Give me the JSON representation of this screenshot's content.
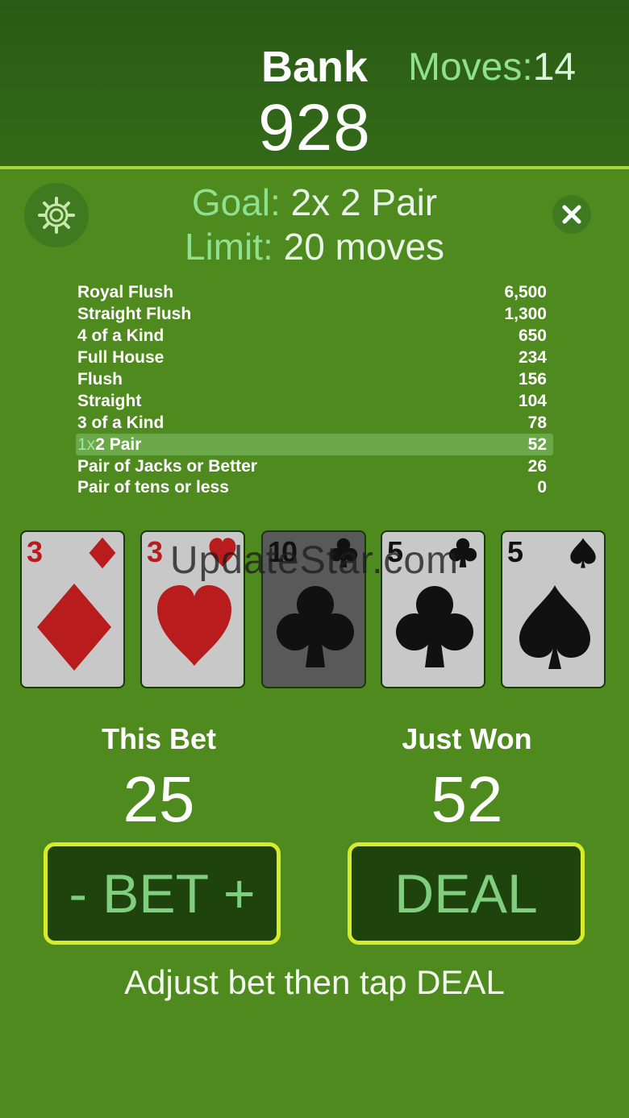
{
  "header": {
    "bank_label": "Bank",
    "bank_value": "928",
    "moves_label": "Moves:",
    "moves_count": "14"
  },
  "goal": {
    "goal_label": "Goal:",
    "goal_value": "2x 2 Pair",
    "limit_label": "Limit:",
    "limit_value": "20 moves"
  },
  "paytable": [
    {
      "mult": "",
      "hand": "Royal Flush",
      "payout": "6,500"
    },
    {
      "mult": "",
      "hand": "Straight Flush",
      "payout": "1,300"
    },
    {
      "mult": "",
      "hand": "4 of a Kind",
      "payout": "650"
    },
    {
      "mult": "",
      "hand": "Full House",
      "payout": "234"
    },
    {
      "mult": "",
      "hand": "Flush",
      "payout": "156"
    },
    {
      "mult": "",
      "hand": "Straight",
      "payout": "104"
    },
    {
      "mult": "",
      "hand": "3 of a Kind",
      "payout": "78"
    },
    {
      "mult": "1x",
      "hand": "2 Pair",
      "payout": "52",
      "highlight": true
    },
    {
      "mult": "",
      "hand": "Pair of Jacks or Better",
      "payout": "26"
    },
    {
      "mult": "",
      "hand": "Pair of tens or less",
      "payout": "0"
    }
  ],
  "cards": [
    {
      "rank": "3",
      "suit": "diamond",
      "color": "red",
      "held": false
    },
    {
      "rank": "3",
      "suit": "heart",
      "color": "red",
      "held": false
    },
    {
      "rank": "10",
      "suit": "club",
      "color": "black",
      "held": true
    },
    {
      "rank": "5",
      "suit": "club",
      "color": "black",
      "held": false
    },
    {
      "rank": "5",
      "suit": "spade",
      "color": "black",
      "held": false
    }
  ],
  "watermark": "UpdateStar.com",
  "stats": {
    "this_bet_label": "This Bet",
    "this_bet_value": "25",
    "just_won_label": "Just Won",
    "just_won_value": "52"
  },
  "buttons": {
    "bet_label": "- BET +",
    "deal_label": "DEAL"
  },
  "hint": "Adjust bet then tap DEAL",
  "colors": {
    "background": "#4e8a1e",
    "header": "#2f6216",
    "accent": "#a8d640",
    "button_border": "#d6ec2a",
    "button_text": "#7fcf7f",
    "goal_label": "#8fe08f"
  }
}
